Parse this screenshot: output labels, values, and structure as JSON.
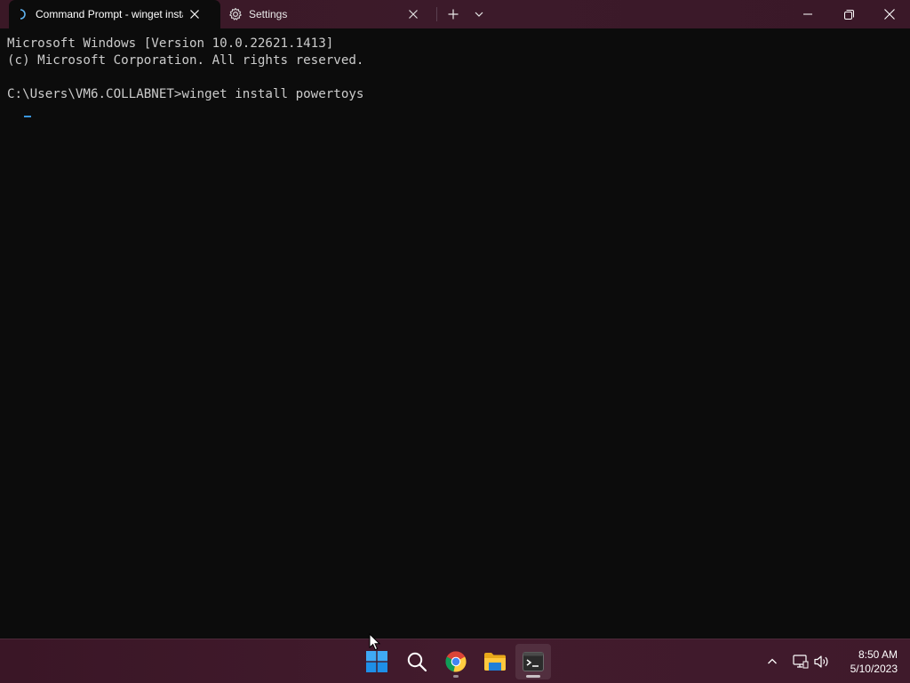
{
  "window": {
    "tabs": [
      {
        "title": "Command Prompt - winget install powertoys",
        "active": true,
        "icon": "terminal-progress-icon"
      },
      {
        "title": "Settings",
        "active": false,
        "icon": "gear-icon"
      }
    ],
    "controls": {
      "new_tab": "plus-icon",
      "dropdown": "chevron-down-icon",
      "minimize": "minimize-icon",
      "maximize": "restore-icon",
      "close": "close-icon"
    }
  },
  "terminal": {
    "lines": [
      "Microsoft Windows [Version 10.0.22621.1413]",
      "(c) Microsoft Corporation. All rights reserved.",
      "",
      "C:\\Users\\VM6.COLLABNET>winget install powertoys"
    ],
    "text_color": "#cccccc",
    "background": "#0c0c0c",
    "cursor_color": "#3a96dd"
  },
  "taskbar": {
    "apps": [
      {
        "name": "Start",
        "icon": "windows-logo-icon"
      },
      {
        "name": "Search",
        "icon": "search-icon"
      },
      {
        "name": "Google Chrome",
        "icon": "chrome-icon",
        "running": true
      },
      {
        "name": "File Explorer",
        "icon": "folder-icon"
      },
      {
        "name": "Terminal",
        "icon": "terminal-icon",
        "running": true,
        "active": true
      }
    ],
    "tray": {
      "icons": [
        "chevron-up-icon",
        "network-icon",
        "volume-icon"
      ]
    },
    "clock": {
      "time": "8:50 AM",
      "date": "5/10/2023"
    }
  },
  "colors": {
    "accent": "#3a96dd",
    "titlebar": "#3c1a2a",
    "taskbar": "#421b2d"
  }
}
